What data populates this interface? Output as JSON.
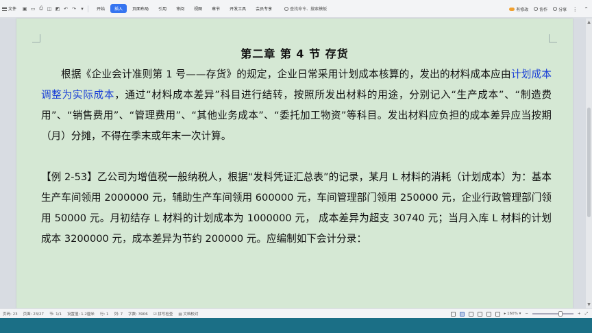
{
  "toolbar": {
    "file_label": "文件",
    "tabs": [
      "开始",
      "插入",
      "页面布局",
      "引用",
      "审阅",
      "视图",
      "章节",
      "开发工具",
      "会员专享"
    ],
    "active_tab": "插入",
    "search_command": "查找命令、搜索模板",
    "right": {
      "cloud_label": "有修改",
      "collab_label": "协作",
      "share_label": "分享"
    }
  },
  "document": {
    "title": "第二章    第 4 节  存货",
    "para1_before": "根据《企业会计准则第 1 号——存货》的规定，企业日常采用计划成本核算的，发出的材料成本应由",
    "para1_highlight": "计划成本调整为实际成本",
    "para1_after": "，通过“材料成本差异”科目进行结转，按照所发出材料的用途，分别记入“生产成本”、“制造费用”、“销售费用”、“管理费用”、“其他业务成本”、“委托加工物资”等科目。发出材料应负担的成本差异应当按期（月）分摊，不得在季末或年末一次计算。",
    "para2": "【例 2-53】乙公司为增值税一般纳税人，根据“发料凭证汇总表”的记录，某月 L 材料的消耗（计划成本）为：基本生产车间领用 2000000 元，辅助生产车间领用 600000 元，车间管理部门领用 250000 元，企业行政管理部门领用 50000 元。月初结存 L 材料的计划成本为 1000000 元， 成本差异为超支 30740 元；当月入库 L 材料的计划成本 3200000 元，成本差异为节约 200000 元。应编制如下会计分录："
  },
  "status": {
    "page": "页码: 23",
    "pages": "页面: 23/27",
    "section": "节: 1/1",
    "setting": "设置值: 1.2厘米",
    "row": "行: 1",
    "col": "列: 7",
    "words": "字数: 3906",
    "spell": "拼写检查",
    "proof": "文档校对",
    "zoom": "160%"
  },
  "colors": {
    "page_bg": "#d5e8d4",
    "highlight": "#1a3fd6",
    "active_tab": "#3574f0",
    "taskbar": "#1b6f86"
  }
}
